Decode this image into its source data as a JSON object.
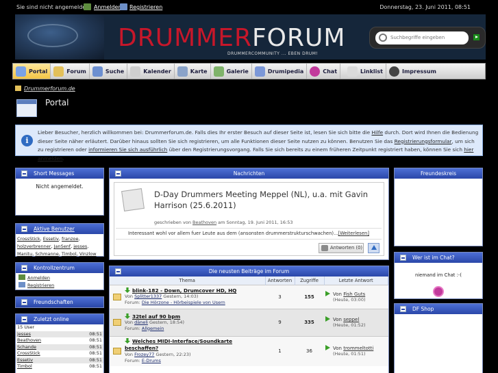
{
  "topbar": {
    "not_logged_in": "Sie sind nicht angemeldet.",
    "login_label": "Anmelden",
    "register_label": "Registrieren",
    "date": "Donnerstag, 23. Juni 2011, 08:51"
  },
  "header": {
    "logo_part1": "DRUMMER",
    "logo_part2": "FORUM",
    "tagline": "DRUMMERCOMMUNITY ... EBEN DRUM!",
    "search_placeholder": "Suchbegriffe eingeben"
  },
  "nav": {
    "items": [
      {
        "label": "Portal",
        "icon": "portal-icon",
        "color": "#7aa2e6"
      },
      {
        "label": "Forum",
        "icon": "forum-icon",
        "color": "#e3c05a"
      },
      {
        "label": "Suche",
        "icon": "search-icon",
        "color": "#6c8fd0"
      },
      {
        "label": "Kalender",
        "icon": "calendar-icon",
        "color": "#cfcfcf"
      },
      {
        "label": "Karte",
        "icon": "map-icon",
        "color": "#8aa3c9"
      },
      {
        "label": "Galerie",
        "icon": "gallery-icon",
        "color": "#7fb36a"
      },
      {
        "label": "Drumipedia",
        "icon": "drumipedia-icon",
        "color": "#7c98d8"
      },
      {
        "label": "Chat",
        "icon": "chat-icon",
        "color": "#c23a9c"
      },
      {
        "label": "Linklist",
        "icon": "linklist-icon",
        "color": "#dadada"
      },
      {
        "label": "Impressum",
        "icon": "impressum-icon",
        "color": "#444444"
      }
    ]
  },
  "breadcrumb": "Drummerforum.de",
  "page_title": "Portal",
  "info": {
    "t1": "Lieber Besucher, herzlich willkommen bei: Drummerforum.de. Falls dies Ihr erster Besuch auf dieser Seite ist, lesen Sie sich bitte die ",
    "l1": "Hilfe",
    "t2": " durch. Dort wird Ihnen die Bedienung dieser Seite näher erläutert. Darüber hinaus sollten Sie sich registrieren, um alle Funktionen dieser Seite nutzen zu können. Benutzen Sie das ",
    "l2": "Registrierungsformular",
    "t3": ", um sich zu registrieren oder ",
    "l3": "informieren Sie sich ausführlich",
    "t4": " über den Registrierungsvorgang. Falls Sie sich bereits zu einem früheren Zeitpunkt registriert haben, können Sie sich ",
    "l4": "hier anmelden",
    "t5": "."
  },
  "short_messages": {
    "title": "Short Messages",
    "text": "Nicht angemeldet."
  },
  "active_users": {
    "title": "Aktive Benutzer",
    "names": [
      "CrossStick",
      "Essetiv",
      "franzoe",
      "holzverbrenner",
      "JanSenf",
      "jesses",
      "Manitu",
      "Schmanne",
      "Timbol",
      "Vinzlow"
    ]
  },
  "control": {
    "title": "Kontrollzentrum",
    "login": "Anmelden",
    "register": "Registrieren"
  },
  "friends_left": {
    "title": "Freundschaften"
  },
  "online": {
    "title": "Zuletzt online",
    "count": "15 User",
    "users": [
      {
        "name": "jesses",
        "time": "08:51"
      },
      {
        "name": "Beathoven",
        "time": "08:51"
      },
      {
        "name": "Schande",
        "time": "08:51"
      },
      {
        "name": "CrossStick",
        "time": "08:51"
      },
      {
        "name": "Essetiv",
        "time": "08:51"
      },
      {
        "name": "Timbol",
        "time": "08:51"
      }
    ]
  },
  "news": {
    "title": "Nachrichten",
    "headline": "D-Day Drummers Meeting Meppel (NL), u.a. mit Gavin Harrison (25.6.2011)",
    "by_prefix": "geschrieben von ",
    "author": "Beathoven",
    "by_suffix": " am Sonntag, 19. Juni 2011, 16:53",
    "teaser": "Interessant wohl vor allem fuer Leute aus dem (ansonsten drummerstrukturschwachen)...",
    "read_more": "[Weiterlesen]",
    "replies": "Antworten (0)"
  },
  "topics": {
    "title": "Die neusten Beiträge im Forum",
    "col_topic": "Thema",
    "col_replies": "Antworten",
    "col_views": "Zugriffe",
    "col_last": "Letzte Antwort",
    "rows": [
      {
        "title": "blink-182 - Down, Drumcover HD, HQ",
        "by": "Von ",
        "author": "Splitter1337",
        "date": " Gestern, 14:03)",
        "forum_prefix": "Forum: ",
        "forum": "Die Hörzone - Hörbeispiele von Usern",
        "replies": "3",
        "views": "155",
        "last_by": "Fish Guts",
        "last_time": "(Heute, 03:00)"
      },
      {
        "title": "32tel auf 90 bpm",
        "by": "Von ",
        "author": "däneli",
        "date": " Gestern, 18:54)",
        "forum_prefix": "Forum: ",
        "forum": "Allgemein",
        "replies": "9",
        "views": "335",
        "last_by": "seppel",
        "last_time": "(Heute, 01:52)"
      },
      {
        "title": "Welches MIDI-Interface/Soundkarte beschaffen?",
        "by": "Von ",
        "author": "Frozey77",
        "date": " Gestern, 22:23)",
        "forum_prefix": "Forum: ",
        "forum": "E-Drums",
        "replies": "1",
        "views": "36",
        "last_by": "trommeltotti",
        "last_time": "(Heute, 01:51)"
      }
    ]
  },
  "right": {
    "friends": "Freundeskreis",
    "chat_title": "Wer ist im Chat?",
    "chat_text": "niemand im Chat :-(",
    "shop_title": "DF Shop"
  }
}
